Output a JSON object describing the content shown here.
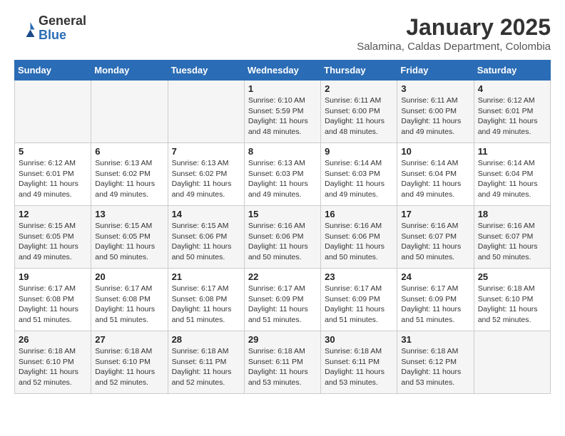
{
  "header": {
    "logo_general": "General",
    "logo_blue": "Blue",
    "month": "January 2025",
    "location": "Salamina, Caldas Department, Colombia"
  },
  "weekdays": [
    "Sunday",
    "Monday",
    "Tuesday",
    "Wednesday",
    "Thursday",
    "Friday",
    "Saturday"
  ],
  "weeks": [
    [
      {
        "day": "",
        "info": ""
      },
      {
        "day": "",
        "info": ""
      },
      {
        "day": "",
        "info": ""
      },
      {
        "day": "1",
        "info": "Sunrise: 6:10 AM\nSunset: 5:59 PM\nDaylight: 11 hours\nand 48 minutes."
      },
      {
        "day": "2",
        "info": "Sunrise: 6:11 AM\nSunset: 6:00 PM\nDaylight: 11 hours\nand 48 minutes."
      },
      {
        "day": "3",
        "info": "Sunrise: 6:11 AM\nSunset: 6:00 PM\nDaylight: 11 hours\nand 49 minutes."
      },
      {
        "day": "4",
        "info": "Sunrise: 6:12 AM\nSunset: 6:01 PM\nDaylight: 11 hours\nand 49 minutes."
      }
    ],
    [
      {
        "day": "5",
        "info": "Sunrise: 6:12 AM\nSunset: 6:01 PM\nDaylight: 11 hours\nand 49 minutes."
      },
      {
        "day": "6",
        "info": "Sunrise: 6:13 AM\nSunset: 6:02 PM\nDaylight: 11 hours\nand 49 minutes."
      },
      {
        "day": "7",
        "info": "Sunrise: 6:13 AM\nSunset: 6:02 PM\nDaylight: 11 hours\nand 49 minutes."
      },
      {
        "day": "8",
        "info": "Sunrise: 6:13 AM\nSunset: 6:03 PM\nDaylight: 11 hours\nand 49 minutes."
      },
      {
        "day": "9",
        "info": "Sunrise: 6:14 AM\nSunset: 6:03 PM\nDaylight: 11 hours\nand 49 minutes."
      },
      {
        "day": "10",
        "info": "Sunrise: 6:14 AM\nSunset: 6:04 PM\nDaylight: 11 hours\nand 49 minutes."
      },
      {
        "day": "11",
        "info": "Sunrise: 6:14 AM\nSunset: 6:04 PM\nDaylight: 11 hours\nand 49 minutes."
      }
    ],
    [
      {
        "day": "12",
        "info": "Sunrise: 6:15 AM\nSunset: 6:05 PM\nDaylight: 11 hours\nand 49 minutes."
      },
      {
        "day": "13",
        "info": "Sunrise: 6:15 AM\nSunset: 6:05 PM\nDaylight: 11 hours\nand 50 minutes."
      },
      {
        "day": "14",
        "info": "Sunrise: 6:15 AM\nSunset: 6:06 PM\nDaylight: 11 hours\nand 50 minutes."
      },
      {
        "day": "15",
        "info": "Sunrise: 6:16 AM\nSunset: 6:06 PM\nDaylight: 11 hours\nand 50 minutes."
      },
      {
        "day": "16",
        "info": "Sunrise: 6:16 AM\nSunset: 6:06 PM\nDaylight: 11 hours\nand 50 minutes."
      },
      {
        "day": "17",
        "info": "Sunrise: 6:16 AM\nSunset: 6:07 PM\nDaylight: 11 hours\nand 50 minutes."
      },
      {
        "day": "18",
        "info": "Sunrise: 6:16 AM\nSunset: 6:07 PM\nDaylight: 11 hours\nand 50 minutes."
      }
    ],
    [
      {
        "day": "19",
        "info": "Sunrise: 6:17 AM\nSunset: 6:08 PM\nDaylight: 11 hours\nand 51 minutes."
      },
      {
        "day": "20",
        "info": "Sunrise: 6:17 AM\nSunset: 6:08 PM\nDaylight: 11 hours\nand 51 minutes."
      },
      {
        "day": "21",
        "info": "Sunrise: 6:17 AM\nSunset: 6:08 PM\nDaylight: 11 hours\nand 51 minutes."
      },
      {
        "day": "22",
        "info": "Sunrise: 6:17 AM\nSunset: 6:09 PM\nDaylight: 11 hours\nand 51 minutes."
      },
      {
        "day": "23",
        "info": "Sunrise: 6:17 AM\nSunset: 6:09 PM\nDaylight: 11 hours\nand 51 minutes."
      },
      {
        "day": "24",
        "info": "Sunrise: 6:17 AM\nSunset: 6:09 PM\nDaylight: 11 hours\nand 51 minutes."
      },
      {
        "day": "25",
        "info": "Sunrise: 6:18 AM\nSunset: 6:10 PM\nDaylight: 11 hours\nand 52 minutes."
      }
    ],
    [
      {
        "day": "26",
        "info": "Sunrise: 6:18 AM\nSunset: 6:10 PM\nDaylight: 11 hours\nand 52 minutes."
      },
      {
        "day": "27",
        "info": "Sunrise: 6:18 AM\nSunset: 6:10 PM\nDaylight: 11 hours\nand 52 minutes."
      },
      {
        "day": "28",
        "info": "Sunrise: 6:18 AM\nSunset: 6:11 PM\nDaylight: 11 hours\nand 52 minutes."
      },
      {
        "day": "29",
        "info": "Sunrise: 6:18 AM\nSunset: 6:11 PM\nDaylight: 11 hours\nand 53 minutes."
      },
      {
        "day": "30",
        "info": "Sunrise: 6:18 AM\nSunset: 6:11 PM\nDaylight: 11 hours\nand 53 minutes."
      },
      {
        "day": "31",
        "info": "Sunrise: 6:18 AM\nSunset: 6:12 PM\nDaylight: 11 hours\nand 53 minutes."
      },
      {
        "day": "",
        "info": ""
      }
    ]
  ]
}
